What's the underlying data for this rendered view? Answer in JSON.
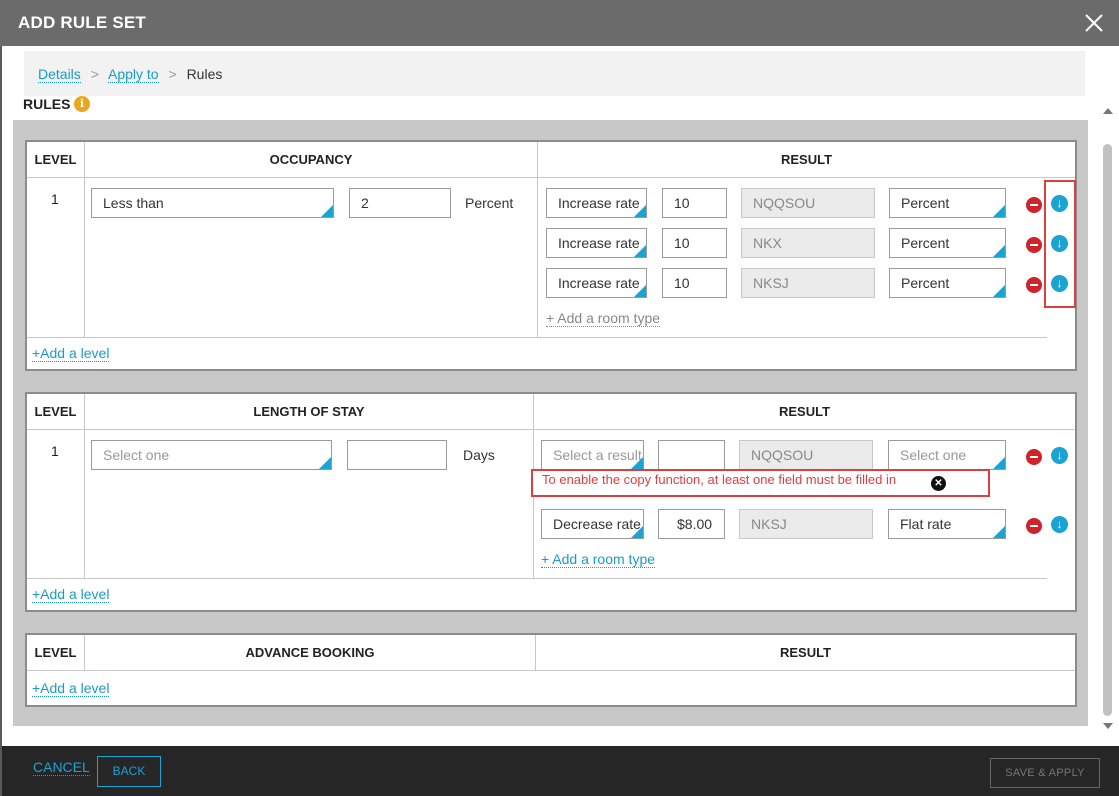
{
  "window": {
    "title": "ADD RULE SET"
  },
  "breadcrumb": {
    "items": [
      "Details",
      "Apply to"
    ],
    "current": "Rules",
    "separator": ">"
  },
  "rules": {
    "label": "RULES"
  },
  "panels": [
    {
      "headers": {
        "level": "LEVEL",
        "criteria": "OCCUPANCY",
        "result": "RESULT"
      },
      "level": "1",
      "criteria": {
        "operator": "Less than",
        "value": "2",
        "unit": "Percent"
      },
      "results": [
        {
          "action": "Increase rate",
          "amount": "10",
          "room": "NQQSOU",
          "type": "Percent"
        },
        {
          "action": "Increase rate",
          "amount": "10",
          "room": "NKX",
          "type": "Percent"
        },
        {
          "action": "Increase rate",
          "amount": "10",
          "room": "NKSJ",
          "type": "Percent"
        }
      ],
      "add_room": "+ Add a room type",
      "add_level": "+Add a level"
    },
    {
      "headers": {
        "level": "LEVEL",
        "criteria": "LENGTH OF STAY",
        "result": "RESULT"
      },
      "level": "1",
      "criteria": {
        "operator_placeholder": "Select one",
        "value": "",
        "unit": "Days"
      },
      "results": [
        {
          "action_placeholder": "Select a result",
          "amount": "",
          "room": "NQQSOU",
          "type_placeholder": "Select one"
        },
        {
          "action": "Decrease rate",
          "amount": "$8.00",
          "room": "NKSJ",
          "type": "Flat rate"
        }
      ],
      "error": "To enable the copy function, at least one field must be filled in",
      "add_room": "+ Add a room type",
      "add_level": "+Add a level"
    },
    {
      "headers": {
        "level": "LEVEL",
        "criteria": "ADVANCE BOOKING",
        "result": "RESULT"
      },
      "add_level": "+Add a level"
    }
  ],
  "footer": {
    "cancel": "CANCEL",
    "back": "BACK",
    "save": "SAVE & APPLY"
  },
  "colors": {
    "accent": "#1ba3d4",
    "error": "#d9403e",
    "remove": "#d0222a",
    "info": "#e9a71e"
  }
}
